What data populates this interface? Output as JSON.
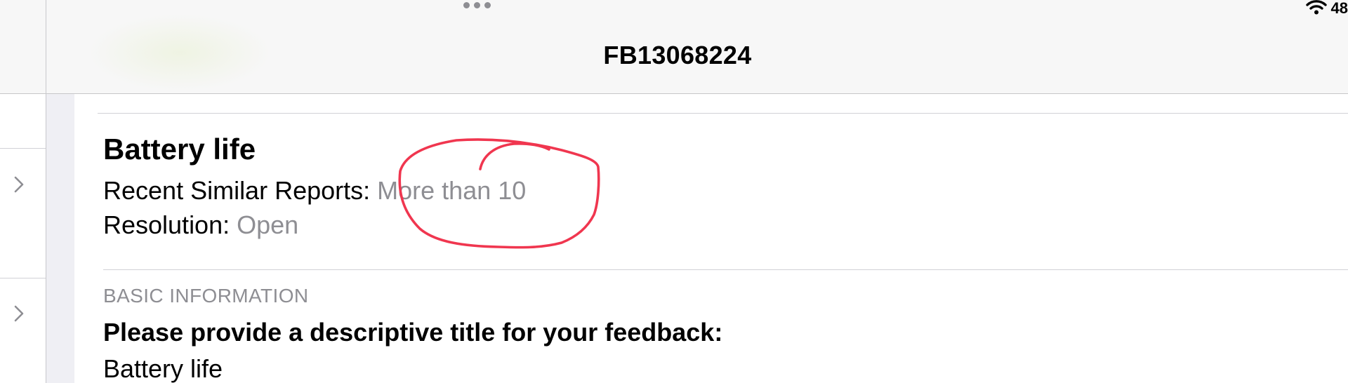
{
  "status_bar": {
    "battery_text": "48"
  },
  "navbar": {
    "title": "FB13068224"
  },
  "report": {
    "title": "Battery life",
    "similar_reports_label": "Recent Similar Reports:",
    "similar_reports_value": "More than 10",
    "resolution_label": "Resolution:",
    "resolution_value": "Open"
  },
  "basic_information": {
    "header": "BASIC INFORMATION",
    "question": "Please provide a descriptive title for your feedback:",
    "answer": "Battery life"
  },
  "annotation": {
    "color": "#f0364f"
  },
  "colors": {
    "secondary_text": "#8e8e93",
    "bar_background": "#f7f7f7",
    "gutter": "#efeff4"
  }
}
